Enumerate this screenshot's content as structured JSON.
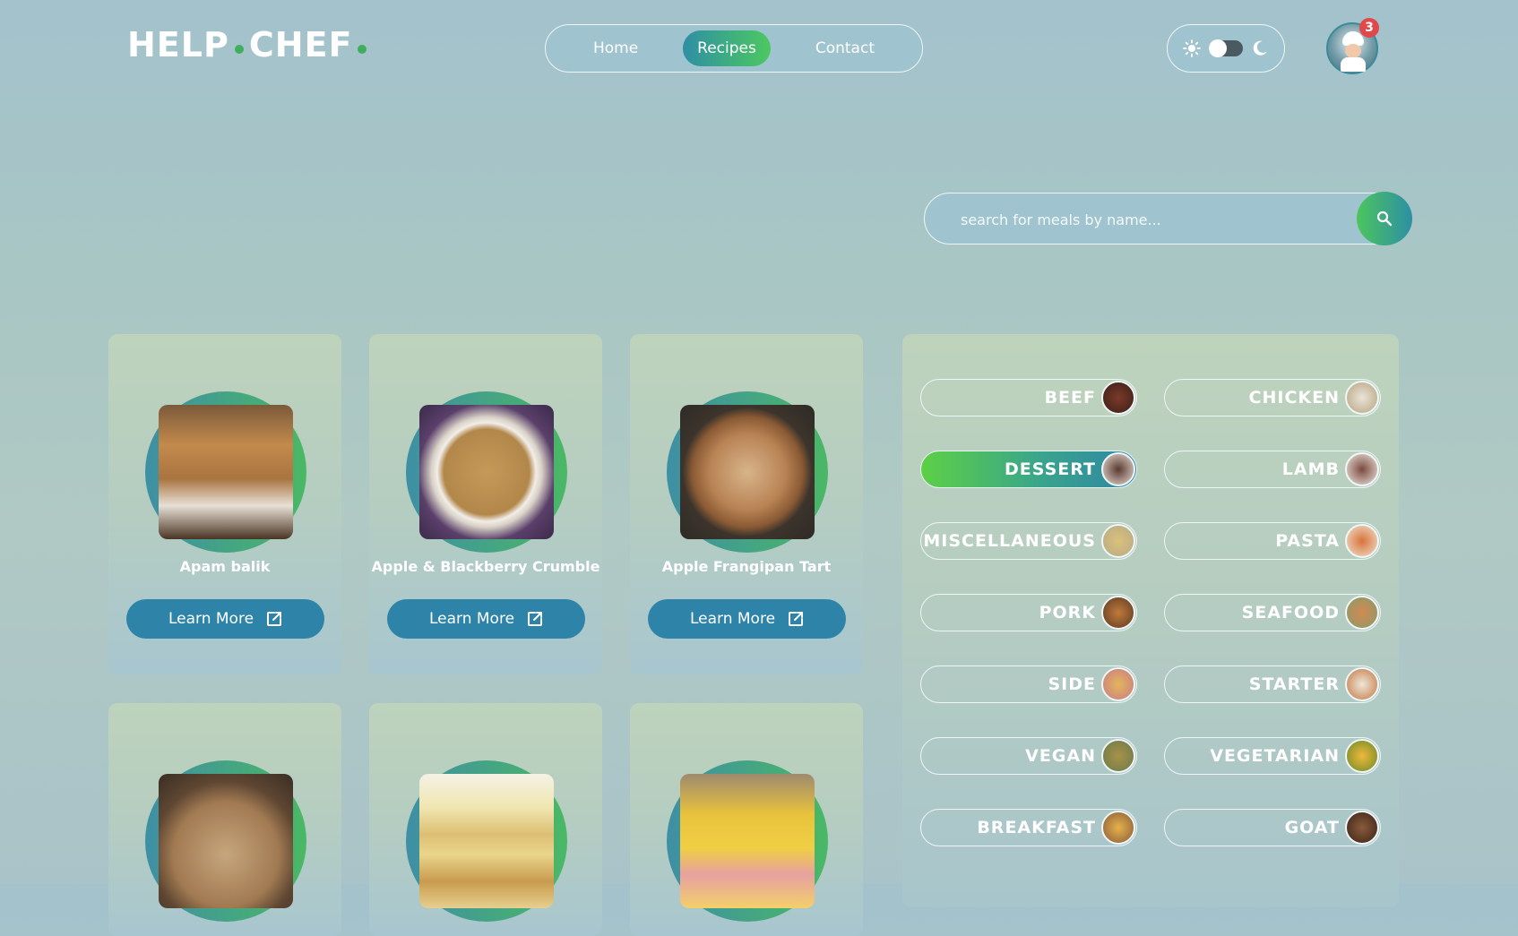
{
  "header": {
    "logo_part1": "HELP",
    "logo_part2": "CHEF",
    "nav": [
      {
        "label": "Home",
        "active": false
      },
      {
        "label": "Recipes",
        "active": true
      },
      {
        "label": "Contact",
        "active": false
      }
    ],
    "notification_count": "3"
  },
  "search": {
    "placeholder": "search for meals by name...",
    "value": ""
  },
  "meals": [
    {
      "name": "Apam balik",
      "button": "Learn More"
    },
    {
      "name": "Apple & Blackberry Crumble",
      "button": "Learn More"
    },
    {
      "name": "Apple Frangipan Tart",
      "button": "Learn More"
    },
    {
      "name": "",
      "button": ""
    },
    {
      "name": "",
      "button": ""
    },
    {
      "name": "",
      "button": ""
    }
  ],
  "categories": [
    {
      "label": "BEEF",
      "active": false
    },
    {
      "label": "CHICKEN",
      "active": false
    },
    {
      "label": "DESSERT",
      "active": true
    },
    {
      "label": "LAMB",
      "active": false
    },
    {
      "label": "MISCELLANEOUS",
      "active": false
    },
    {
      "label": "PASTA",
      "active": false
    },
    {
      "label": "PORK",
      "active": false
    },
    {
      "label": "SEAFOOD",
      "active": false
    },
    {
      "label": "SIDE",
      "active": false
    },
    {
      "label": "STARTER",
      "active": false
    },
    {
      "label": "VEGAN",
      "active": false
    },
    {
      "label": "VEGETARIAN",
      "active": false
    },
    {
      "label": "BREAKFAST",
      "active": false
    },
    {
      "label": "GOAT",
      "active": false
    }
  ],
  "colors": {
    "accent_green": "#4cc55e",
    "accent_teal": "#2d84a8",
    "badge_red": "#e2474a"
  }
}
